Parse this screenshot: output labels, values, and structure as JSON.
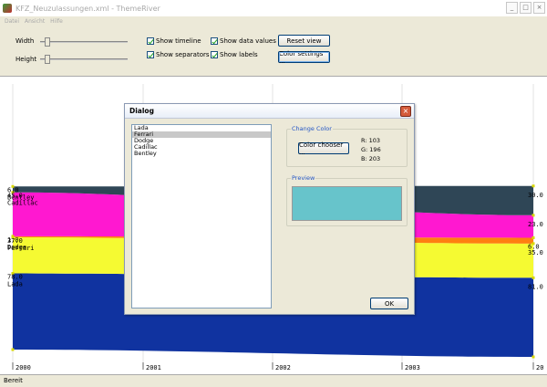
{
  "window": {
    "title": "KFZ_Neuzulassungen.xml - ThemeRiver",
    "min": "_",
    "max": "□",
    "close": "×"
  },
  "menu": [
    "Datei",
    "Ansicht",
    "Hilfe"
  ],
  "controls": {
    "width_label": "Width",
    "height_label": "Height",
    "width_value": 0.05,
    "height_value": 0.05,
    "show_timeline": "Show timeline",
    "show_separators": "Show separators",
    "show_data_values": "Show data values",
    "show_labels": "Show labels",
    "reset_view": "Reset view",
    "color_settings": "Color settings ..."
  },
  "colors": {
    "Lada": "#1033a0",
    "Ferrari": "#f5fa32",
    "Dodge": "#ff7f10",
    "Cadillac": "#ff18d0",
    "Bentley": "#2f4656"
  },
  "chart_data": {
    "type": "area",
    "years": [
      "2000",
      "2001",
      "2002",
      "2003",
      "20"
    ],
    "series": [
      {
        "name": "Lada",
        "values": [
          78.0,
          null,
          null,
          null,
          81.0
        ]
      },
      {
        "name": "Ferrari",
        "values": [
          37.0,
          null,
          null,
          null,
          35.0
        ]
      },
      {
        "name": "Dodge",
        "values": [
          1.0,
          null,
          null,
          null,
          6.0
        ]
      },
      {
        "name": "Cadillac",
        "values": [
          45.0,
          null,
          null,
          null,
          23.0
        ]
      },
      {
        "name": "Bentley",
        "values": [
          6.0,
          null,
          null,
          null,
          30.0
        ]
      }
    ],
    "left_labels": [
      {
        "value": "6.0",
        "name": "Bentley"
      },
      {
        "value": "45.0",
        "name": "Cadillac"
      },
      {
        "value": "1.0",
        "name": "Dodge"
      },
      {
        "value": "37.0",
        "name": "Ferrari"
      },
      {
        "value": "78.0",
        "name": "Lada"
      }
    ],
    "right_labels": [
      "30.0",
      "23.0",
      "6.0",
      "35.0",
      "81.0"
    ]
  },
  "dialog": {
    "title": "Dialog",
    "close": "×",
    "list": [
      "Lada",
      "Ferrari",
      "Dodge",
      "Cadillac",
      "Bentley"
    ],
    "selected": "Ferrari",
    "change_color": "Change Color",
    "color_chooser": "Color chooser ...",
    "r": "R: 103",
    "g": "G: 196",
    "b": "B: 203",
    "preview_label": "Preview",
    "preview_color": "#67c4cb",
    "ok": "OK"
  },
  "status": "Bereit"
}
